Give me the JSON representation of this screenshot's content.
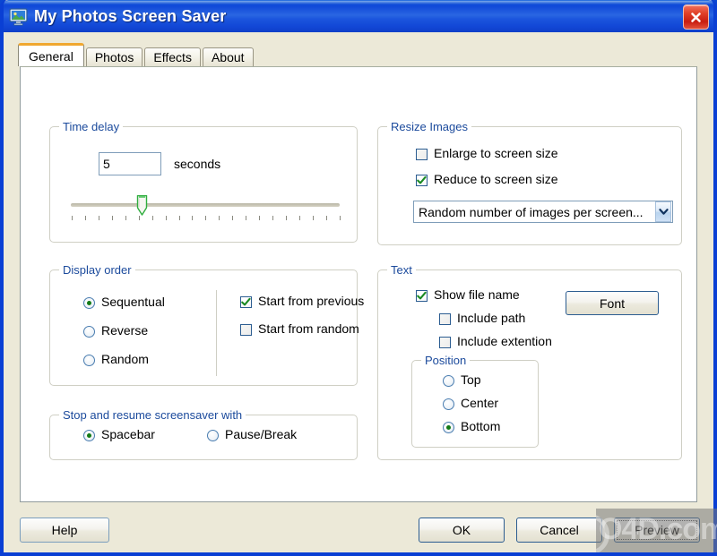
{
  "window": {
    "title": "My Photos Screen Saver",
    "icon": "monitor-photo-icon",
    "close_label": "✕",
    "accent_titlebar": "#1149d9",
    "accent_group_label": "#1b4a9c",
    "accent_active_tab": "#f0a730",
    "dialog_background": "#ece9d8"
  },
  "tabs": [
    {
      "label": "General",
      "active": true
    },
    {
      "label": "Photos",
      "active": false
    },
    {
      "label": "Effects",
      "active": false
    },
    {
      "label": "About",
      "active": false
    }
  ],
  "time_delay": {
    "legend": "Time delay",
    "value": "5",
    "units_label": "seconds",
    "slider": {
      "min": 0,
      "max": 20,
      "value": 5,
      "tick_count": 21
    }
  },
  "resize_images": {
    "legend": "Resize Images",
    "checkboxes": [
      {
        "label": "Enlarge to screen size",
        "checked": false
      },
      {
        "label": "Reduce to screen size",
        "checked": true
      }
    ],
    "combo": {
      "selected": "Random number of images per screen...",
      "options": [
        "Random number of images per screen..."
      ]
    }
  },
  "display_order": {
    "legend": "Display order",
    "radios": [
      {
        "label": "Sequentual",
        "selected": true
      },
      {
        "label": "Reverse",
        "selected": false
      },
      {
        "label": "Random",
        "selected": false
      }
    ],
    "checkboxes": [
      {
        "label": "Start from previous",
        "checked": true
      },
      {
        "label": "Start from random",
        "checked": false
      }
    ]
  },
  "stop_resume": {
    "legend": "Stop and resume screensaver with",
    "radios": [
      {
        "label": "Spacebar",
        "selected": true
      },
      {
        "label": "Pause/Break",
        "selected": false
      }
    ]
  },
  "text_group": {
    "legend": "Text",
    "show_file_name": {
      "label": "Show file name",
      "checked": true
    },
    "sub_checkboxes": [
      {
        "label": "Include path",
        "checked": false
      },
      {
        "label": "Include extention",
        "checked": false
      }
    ],
    "font_button": "Font",
    "position": {
      "legend": "Position",
      "radios": [
        {
          "label": "Top",
          "selected": false
        },
        {
          "label": "Center",
          "selected": false
        },
        {
          "label": "Bottom",
          "selected": true
        }
      ]
    }
  },
  "footer": {
    "help": "Help",
    "ok": "OK",
    "cancel": "Cancel",
    "preview": "Preview"
  },
  "watermark": {
    "text": "O4D.com"
  }
}
